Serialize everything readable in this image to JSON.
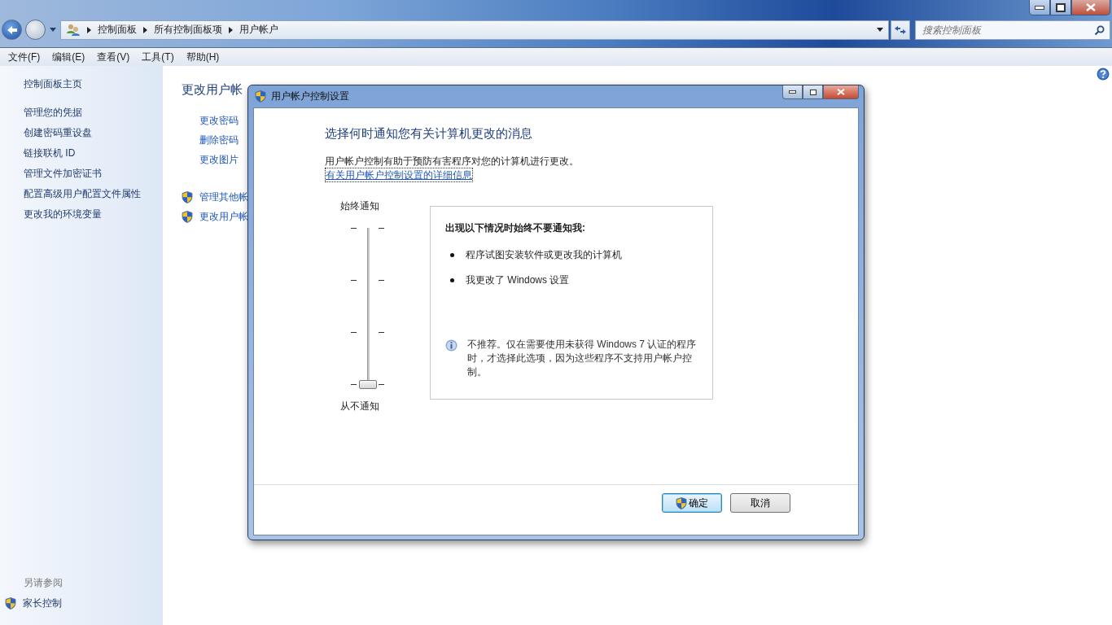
{
  "address": {
    "breadcrumb": [
      "控制面板",
      "所有控制面板项",
      "用户帐户"
    ]
  },
  "search": {
    "placeholder": "搜索控制面板"
  },
  "menu": [
    "文件(F)",
    "编辑(E)",
    "查看(V)",
    "工具(T)",
    "帮助(H)"
  ],
  "sidebar": {
    "items": [
      "控制面板主页",
      "管理您的凭据",
      "创建密码重设盘",
      "链接联机 ID",
      "管理文件加密证书",
      "配置高级用户配置文件属性",
      "更改我的环境变量"
    ],
    "see_also_title": "另请参阅",
    "see_also": [
      {
        "label": "家长控制",
        "kind": "shield"
      }
    ]
  },
  "content": {
    "heading": "更改用户帐",
    "links": [
      {
        "label": "更改密码",
        "kind": "plain"
      },
      {
        "label": "删除密码",
        "kind": "plain"
      },
      {
        "label": "更改图片",
        "kind": "plain"
      },
      {
        "label": "管理其他帐",
        "kind": "shield"
      },
      {
        "label": "更改用户帐",
        "kind": "shield"
      }
    ]
  },
  "dialog": {
    "title": "用户帐户控制设置",
    "heading": "选择何时通知您有关计算机更改的消息",
    "description": "用户帐户控制有助于预防有害程序对您的计算机进行更改。",
    "link": "有关用户帐户控制设置的详细信息",
    "slider": {
      "top_label": "始终通知",
      "bottom_label": "从不通知",
      "level": 0
    },
    "info": {
      "title": "出现以下情况时始终不要通知我:",
      "bullets": [
        "程序试图安装软件或更改我的计算机",
        "我更改了 Windows 设置"
      ],
      "note": "不推荐。仅在需要使用未获得 Windows 7 认证的程序时，才选择此选项，因为这些程序不支持用户帐户控制。"
    },
    "buttons": [
      {
        "label": "确定",
        "kind": "shield",
        "default": true
      },
      {
        "label": "取消",
        "kind": "plain",
        "default": false
      }
    ]
  }
}
